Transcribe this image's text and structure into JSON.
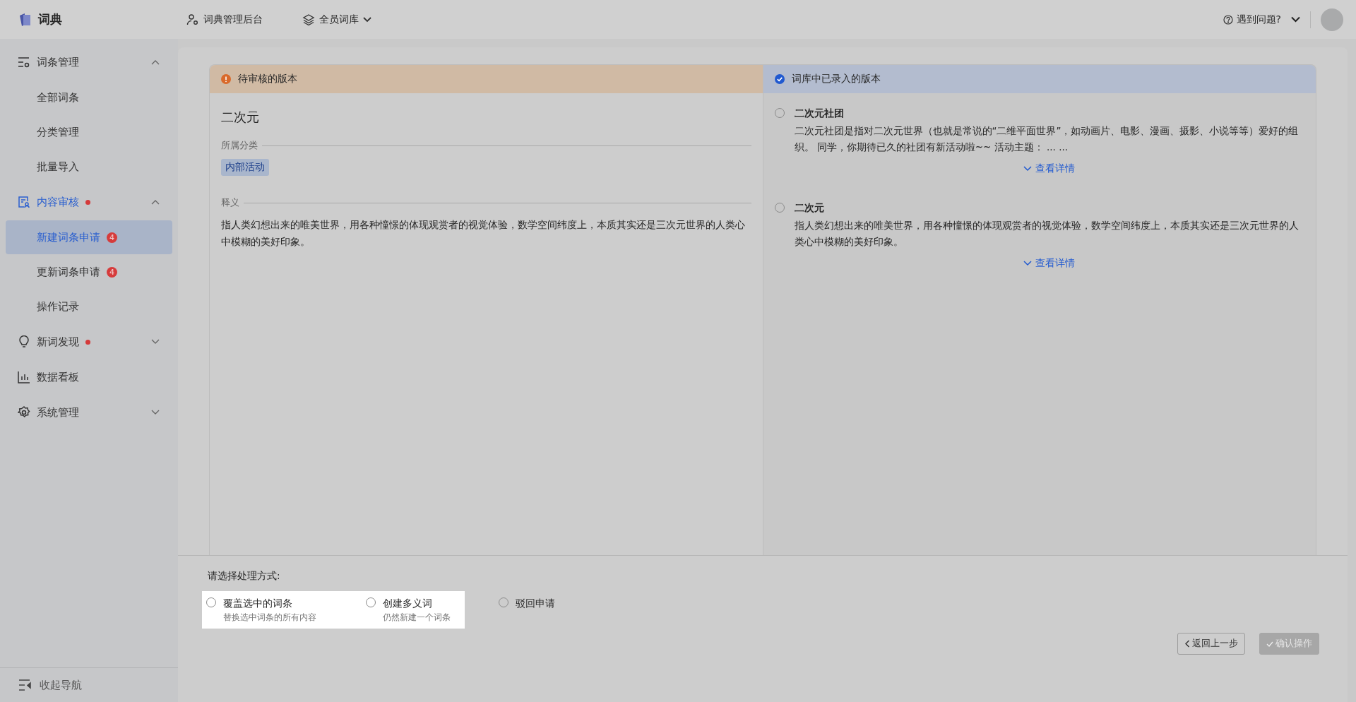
{
  "header": {
    "logo": "词典",
    "nav": [
      {
        "kind": "admin",
        "label": "词典管理后台"
      },
      {
        "kind": "library",
        "label": "全员词库"
      }
    ],
    "help": "遇到问题?"
  },
  "sidebar": {
    "items": [
      {
        "label": "词条管理",
        "expanded": true,
        "selected": false,
        "dot": false,
        "children": [
          {
            "label": "全部词条",
            "selected": false
          },
          {
            "label": "分类管理",
            "selected": false
          },
          {
            "label": "批量导入",
            "selected": false
          }
        ]
      },
      {
        "label": "内容审核",
        "expanded": true,
        "selected": true,
        "dot": true,
        "children": [
          {
            "label": "新建词条申请",
            "selected": true,
            "badge": "4"
          },
          {
            "label": "更新词条申请",
            "selected": false,
            "badge": "4"
          },
          {
            "label": "操作记录",
            "selected": false
          }
        ]
      },
      {
        "label": "新词发现",
        "expanded": false,
        "selected": false,
        "dot": true
      },
      {
        "label": "数据看板",
        "selected": false,
        "dot": false
      },
      {
        "label": "系统管理",
        "expanded": false,
        "selected": false,
        "dot": false
      }
    ],
    "collapse": "收起导航"
  },
  "pending": {
    "header": "待审核的版本",
    "term": "二次元",
    "category_label": "所属分类",
    "category": "内部活动",
    "definition_label": "释义",
    "definition": "指人类幻想出来的唯美世界，用各种憧憬的体现观赏者的视觉体验，数学空间纬度上，本质其实还是三次元世界的人类心中模糊的美好印象。"
  },
  "existing": {
    "header": "词库中已录入的版本",
    "entries": [
      {
        "term": "二次元社团",
        "selected": false,
        "text": "二次元社团是指对二次元世界（也就是常说的“二维平面世界”，如动画片、电影、漫画、摄影、小说等等）爱好的组织。 同学，你期待已久的社团有新活动啦~~ 活动主题： ... ...",
        "link": "查看详情"
      },
      {
        "term": "二次元",
        "selected": false,
        "text": "指人类幻想出来的唯美世界，用各种憧憬的体现观赏者的视觉体验，数学空间纬度上，本质其实还是三次元世界的人类心中模糊的美好印象。",
        "link": "查看详情"
      }
    ]
  },
  "action": {
    "prompt": "请选择处理方式:",
    "options": [
      {
        "label": "覆盖选中的词条",
        "hint": "替换选中词条的所有内容",
        "selected": false,
        "highlighted": true
      },
      {
        "label": "创建多义词",
        "hint": "仍然新建一个词条",
        "selected": false,
        "highlighted": true
      },
      {
        "label": "驳回申请",
        "selected": false,
        "highlighted": false
      }
    ],
    "buttons": [
      {
        "kind": "back",
        "label": "返回上一步"
      },
      {
        "kind": "confirm",
        "label": "确认操作",
        "disabled": true
      }
    ]
  }
}
